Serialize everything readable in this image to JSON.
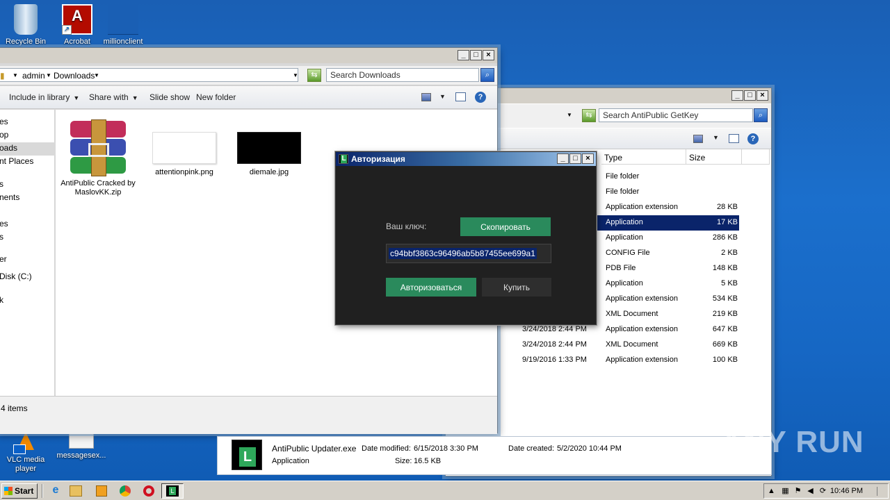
{
  "desktop": {
    "icons": [
      {
        "label": "Recycle Bin"
      },
      {
        "label": "Acrobat"
      },
      {
        "label": "millionclient"
      },
      {
        "label": "VLC media player"
      },
      {
        "label": "messagesex..."
      }
    ]
  },
  "downloads_window": {
    "breadcrumb": [
      "admin",
      "Downloads"
    ],
    "search_placeholder": "Search Downloads",
    "toolbar": {
      "include_library": "Include in library",
      "share_with": "Share with",
      "slide_show": "Slide show",
      "new_folder": "New folder"
    },
    "nav_items": [
      "es",
      "op",
      "oads",
      "nt Places",
      "s",
      "nents",
      "es",
      "s",
      "er",
      "Disk (C:)",
      "k"
    ],
    "files": [
      {
        "name": "AntiPublic Cracked by MaslovKK.zip"
      },
      {
        "name": "attentionpink.png"
      },
      {
        "name": "diemale.jpg"
      }
    ],
    "status": "4 items"
  },
  "antipublic_window": {
    "search_placeholder": "Search AntiPublic GetKey",
    "columns": {
      "type": "Type",
      "size": "Size"
    },
    "rows": [
      {
        "date": "",
        "type": "File folder",
        "size": ""
      },
      {
        "date": "",
        "type": "File folder",
        "size": ""
      },
      {
        "date": "",
        "type": "Application extension",
        "size": "28 KB"
      },
      {
        "date": "",
        "type": "Application",
        "size": "17 KB",
        "selected": true
      },
      {
        "date": "",
        "type": "Application",
        "size": "286 KB"
      },
      {
        "date": "",
        "type": "CONFIG File",
        "size": "2 KB"
      },
      {
        "date": "",
        "type": "PDB File",
        "size": "148 KB"
      },
      {
        "date": "",
        "type": "Application",
        "size": "5 KB"
      },
      {
        "date": "",
        "type": "Application extension",
        "size": "534 KB"
      },
      {
        "date": "",
        "type": "XML Document",
        "size": "219 KB"
      },
      {
        "date": "3/24/2018 2:44 PM",
        "type": "Application extension",
        "size": "647 KB"
      },
      {
        "date": "3/24/2018 2:44 PM",
        "type": "XML Document",
        "size": "669 KB"
      },
      {
        "date": "9/19/2016 1:33 PM",
        "type": "Application extension",
        "size": "100 KB"
      }
    ]
  },
  "details": {
    "filename": "AntiPublic Updater.exe",
    "modified_label": "Date modified:",
    "modified": "6/15/2018 3:30 PM",
    "created_label": "Date created:",
    "created": "5/2/2020 10:44 PM",
    "type": "Application",
    "size_label": "Size:",
    "size": "16.5 KB"
  },
  "dialog": {
    "title": "Авторизация",
    "key_label": "Ваш ключ:",
    "copy_button": "Скопировать",
    "key_value": "c94bbf3863c96496ab5b87455ee699a1",
    "authorize_button": "Авторизоваться",
    "buy_button": "Купить",
    "accent": "#2a8a5c"
  },
  "taskbar": {
    "start": "Start",
    "clock": "10:46 PM"
  },
  "watermark": "ANY RUN"
}
